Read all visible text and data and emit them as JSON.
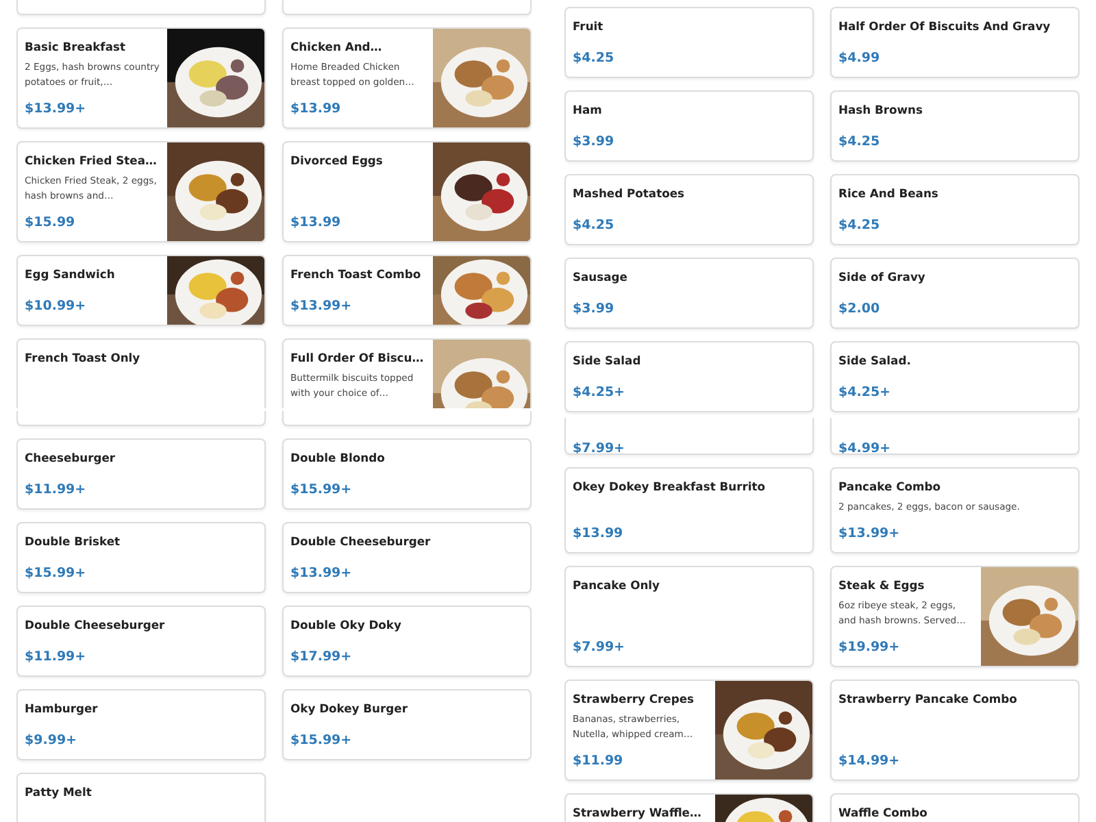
{
  "panels": [
    {
      "sections": [
        {
          "cards": [
            {
              "kind": "plain"
            },
            {
              "kind": "plain"
            },
            {
              "name": "Basic Breakfast",
              "description": "2 Eggs, hash browns country potatoes or fruit,…",
              "price": "$13.99+"
            },
            {
              "name": "Chicken And…",
              "description": "Home Breaded Chicken breast topped on golden…",
              "price": "$13.99"
            },
            {
              "name": "Chicken Fried Stea…",
              "description": "Chicken Fried Steak, 2 eggs, hash browns and…",
              "price": "$15.99"
            },
            {
              "name": "Divorced Eggs",
              "price": "$13.99"
            },
            {
              "name": "Egg Sandwich",
              "price": "$10.99+"
            },
            {
              "name": "French Toast Combo",
              "price": "$13.99+"
            },
            {
              "kind": "plain",
              "name": "French Toast Only"
            },
            {
              "name": "Full Order Of Biscu…",
              "description": "Buttermilk biscuits topped with your choice of…"
            }
          ]
        },
        {
          "cards": [
            {
              "kind": "plain"
            },
            {
              "kind": "plain"
            },
            {
              "kind": "plain",
              "name": "Cheeseburger",
              "price": "$11.99+"
            },
            {
              "kind": "plain",
              "name": "Double Blondo",
              "price": "$15.99+"
            },
            {
              "kind": "plain",
              "name": "Double Brisket",
              "price": "$15.99+"
            },
            {
              "kind": "plain",
              "name": "Double Cheeseburger",
              "price": "$13.99+"
            },
            {
              "kind": "plain",
              "name": "Double Cheeseburger",
              "price": "$11.99+"
            },
            {
              "kind": "plain",
              "name": "Double Oky Doky",
              "price": "$17.99+"
            },
            {
              "kind": "plain",
              "name": "Hamburger",
              "price": "$9.99+"
            },
            {
              "kind": "plain",
              "name": "Oky Dokey Burger",
              "price": "$15.99+"
            },
            {
              "kind": "plain",
              "name": "Patty Melt"
            }
          ]
        }
      ]
    },
    {
      "sections": [
        {
          "cards": [
            {
              "kind": "plain",
              "name": "Fruit",
              "price": "$4.25"
            },
            {
              "kind": "plain",
              "name": "Half Order Of Biscuits And Gravy",
              "price": "$4.99"
            },
            {
              "kind": "plain",
              "name": "Ham",
              "price": "$3.99"
            },
            {
              "kind": "plain",
              "name": "Hash Browns",
              "price": "$4.25"
            },
            {
              "kind": "plain",
              "name": "Mashed Potatoes",
              "price": "$4.25"
            },
            {
              "kind": "plain",
              "name": "Rice And Beans",
              "price": "$4.25"
            },
            {
              "kind": "plain",
              "name": "Sausage",
              "price": "$3.99"
            },
            {
              "kind": "plain",
              "name": "Side of Gravy",
              "price": "$2.00"
            },
            {
              "kind": "plain",
              "name": "Side Salad",
              "price": "$4.25+"
            },
            {
              "kind": "plain",
              "name": "Side Salad.",
              "price": "$4.25+"
            }
          ]
        },
        {
          "cards": [
            {
              "kind": "plain",
              "price": "$7.99+"
            },
            {
              "kind": "plain",
              "price": "$4.99+"
            },
            {
              "kind": "plain",
              "name": "Okey Dokey Breakfast Burrito",
              "price": "$13.99"
            },
            {
              "kind": "plain",
              "name": "Pancake Combo",
              "description": "2 pancakes, 2 eggs, bacon or sausage.",
              "price": "$13.99+"
            },
            {
              "kind": "plain",
              "name": "Pancake Only",
              "price": "$7.99+"
            },
            {
              "name": "Steak & Eggs",
              "description": "6oz ribeye steak, 2 eggs, and hash browns. Served…",
              "price": "$19.99+"
            },
            {
              "name": "Strawberry Crepes",
              "description": "Bananas, strawberries, Nutella, whipped cream…",
              "price": "$11.99"
            },
            {
              "kind": "plain",
              "name": "Strawberry Pancake Combo",
              "price": "$14.99+"
            },
            {
              "name": "Strawberry Waffle…"
            },
            {
              "kind": "plain",
              "name": "Waffle Combo"
            }
          ]
        }
      ]
    }
  ]
}
